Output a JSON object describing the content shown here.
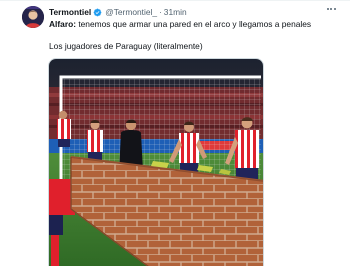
{
  "tweet": {
    "display_name": "Termontiel",
    "handle": "@Termontiel_",
    "separator": "·",
    "timestamp": "31min",
    "line1_speaker": "Alfaro:",
    "line1_text": " tenemos que armar una pared en el arco y llegamos a penales",
    "line2": "Los jugadores de Paraguay (literalmente)"
  },
  "icons": {
    "verified": "verified-badge-icon",
    "more": "more-options-icon"
  },
  "colors": {
    "verified_blue": "#1d9bf0",
    "text_primary": "#0f1419",
    "text_secondary": "#536471"
  }
}
